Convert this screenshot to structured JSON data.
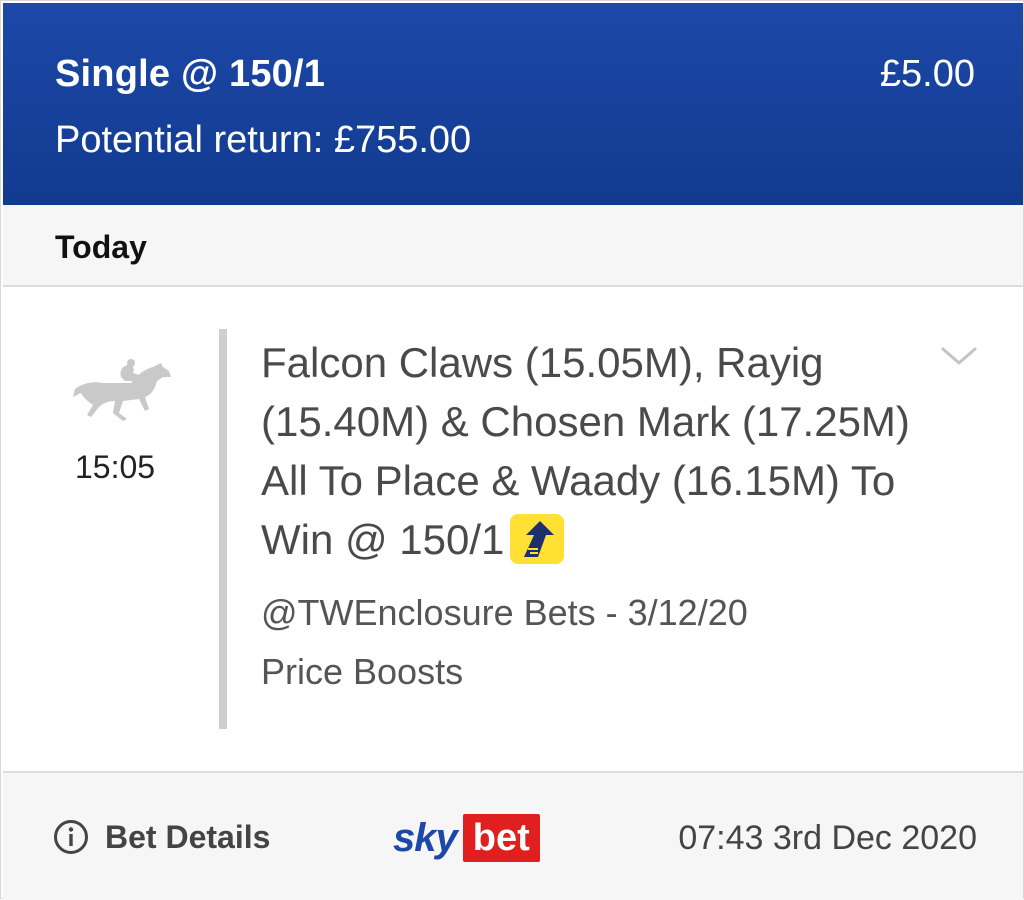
{
  "header": {
    "bet_type": "Single @ 150/1",
    "stake": "£5.00",
    "potential_return": "Potential return: £755.00"
  },
  "day_label": "Today",
  "event": {
    "icon": "horse-racing-icon",
    "time": "15:05",
    "selection": "Falcon Claws (15.05M), Rayig (15.40M) & Chosen Mark (17.25M) All To Place & Waady (16.15M) To Win @ 150/1",
    "boost_icon": "price-boost-arrow-icon",
    "source_line1": "@TWEnclosure Bets - 3/12/20",
    "source_line2": "Price Boosts"
  },
  "footer": {
    "bet_details_label": "Bet Details",
    "logo_sky": "sky",
    "logo_bet": "bet",
    "placed_at": "07:43 3rd Dec 2020"
  },
  "colors": {
    "header_blue": "#1c48a8",
    "boost_yellow": "#ffe033",
    "brand_red": "#e0201f"
  }
}
